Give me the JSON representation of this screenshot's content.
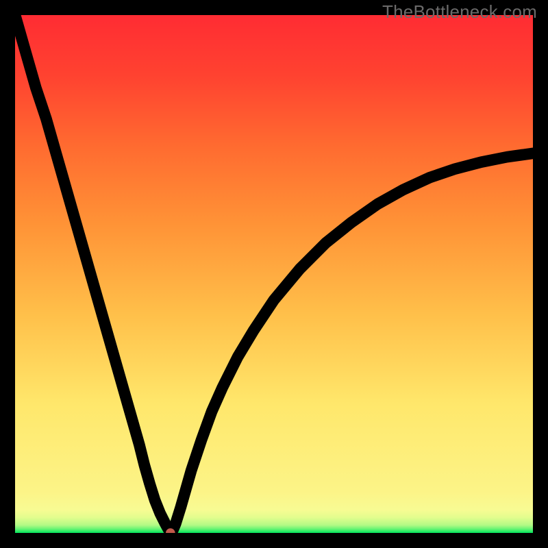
{
  "watermark": "TheBottleneck.com",
  "colors": {
    "curve": "#000000",
    "marker": "#c25a4b",
    "frame_bg": "#000000"
  },
  "chart_data": {
    "type": "line",
    "title": "",
    "xlabel": "",
    "ylabel": "",
    "xlim": [
      0,
      100
    ],
    "ylim": [
      0,
      100
    ],
    "legend": false,
    "grid": false,
    "min_marker": {
      "x": 30,
      "y": 0
    },
    "x": [
      0,
      2,
      4,
      6,
      8,
      10,
      12,
      14,
      16,
      18,
      20,
      22,
      24,
      25,
      26,
      27,
      28,
      29,
      29.5,
      30,
      30.5,
      31,
      32,
      33,
      34,
      36,
      38,
      40,
      43,
      46,
      50,
      55,
      60,
      65,
      70,
      75,
      80,
      85,
      90,
      95,
      100
    ],
    "y": [
      100,
      93,
      86,
      80,
      73,
      66,
      59,
      52,
      45,
      38,
      31,
      24,
      17,
      13,
      9.5,
      6.3,
      3.8,
      1.8,
      0.9,
      0.0,
      0.6,
      1.8,
      5.0,
      8.5,
      12,
      18,
      23.5,
      28,
      34,
      39,
      45,
      51,
      56,
      60,
      63.5,
      66.3,
      68.6,
      70.3,
      71.6,
      72.6,
      73.3
    ]
  }
}
